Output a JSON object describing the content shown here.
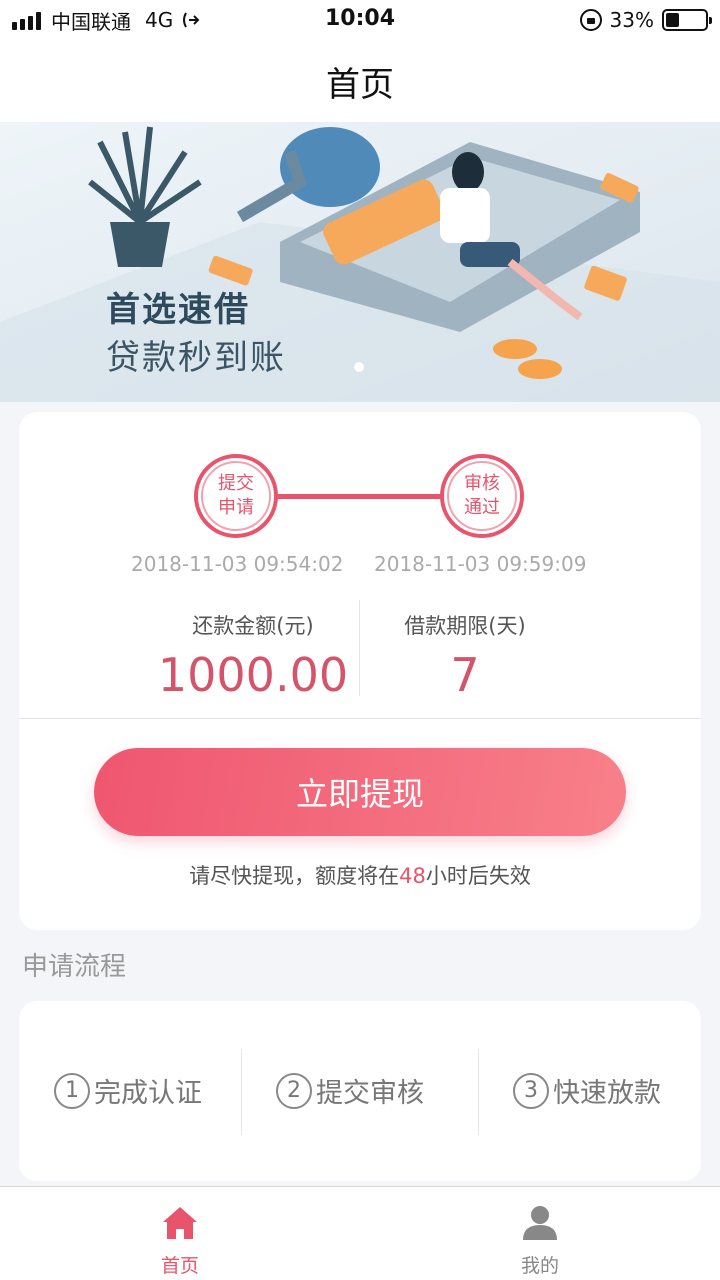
{
  "status_bar": {
    "carrier": "中国联通",
    "network": "4G",
    "time": "10:04",
    "battery": "33%",
    "battery_level": 0.33
  },
  "nav": {
    "title": "首页"
  },
  "banner": {
    "title": "首选速借",
    "subtitle": "贷款秒到账"
  },
  "loan": {
    "steps": [
      {
        "line1": "提交",
        "line2": "申请",
        "time": "2018-11-03 09:54:02"
      },
      {
        "line1": "审核",
        "line2": "通过",
        "time": "2018-11-03 09:59:09"
      }
    ],
    "amount_label": "还款金额(元)",
    "amount_value": "1000.00",
    "term_label": "借款期限(天)",
    "term_value": "7",
    "withdraw_button": "立即提现",
    "notice_prefix": "请尽快提现，额度将在",
    "notice_hours": "48",
    "notice_suffix": "小时后失效",
    "accent_color": "#e8546c"
  },
  "process": {
    "title": "申请流程",
    "items": [
      {
        "num": "1",
        "label": "完成认证"
      },
      {
        "num": "2",
        "label": "提交审核"
      },
      {
        "num": "3",
        "label": "快速放款"
      }
    ]
  },
  "tabs": [
    {
      "label": "首页",
      "icon": "home-icon",
      "active": true,
      "color": "#e8546c"
    },
    {
      "label": "我的",
      "icon": "user-icon",
      "active": false,
      "color": "#888888"
    }
  ]
}
